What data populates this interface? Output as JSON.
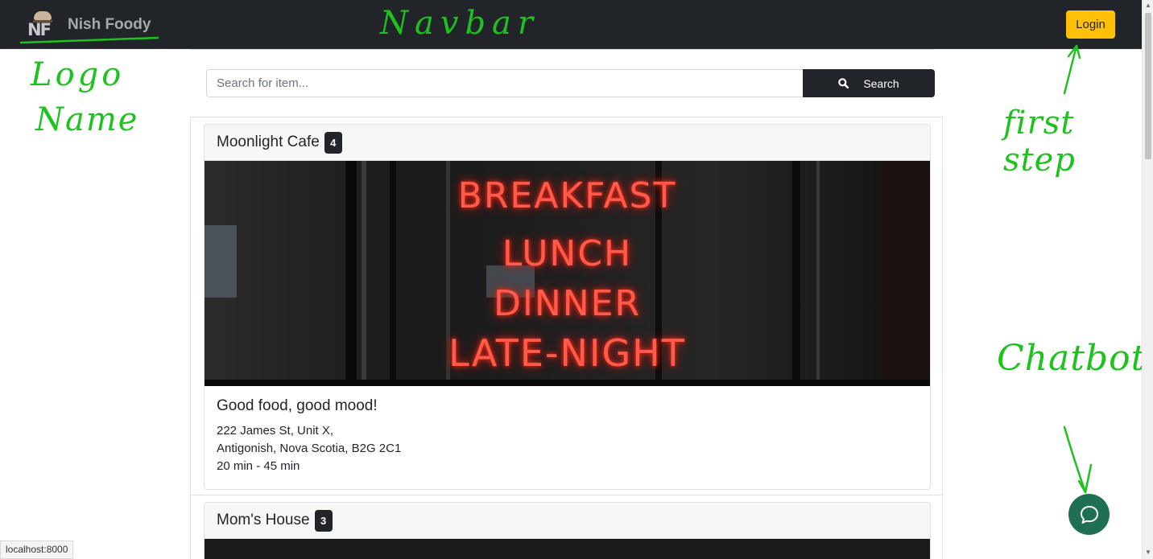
{
  "navbar": {
    "brand_logo_text": "NF",
    "brand_name": "Nish Foody",
    "login_label": "Login"
  },
  "search": {
    "placeholder": "Search for item...",
    "button_label": "Search"
  },
  "restaurants": [
    {
      "name": "Moonlight Cafe",
      "count": "4",
      "image_text": [
        "BREAKFAST",
        "LUNCH",
        "DINNER",
        "LATE-NIGHT"
      ],
      "tagline": "Good food, good mood!",
      "address_line1": "222 James St, Unit X,",
      "address_line2": "Antigonish, Nova Scotia, B2G 2C1",
      "delivery_time": "20 min - 45 min"
    },
    {
      "name": "Mom's House",
      "count": "3"
    }
  ],
  "annotations": {
    "navbar": "Navbar",
    "logo": "Logo",
    "name": "Name",
    "first_step": "first step",
    "chatbot": "Chatbot"
  },
  "status_bar": "localhost:8000",
  "colors": {
    "navbar_bg": "#212529",
    "login_bg": "#ffc107",
    "chat_bg": "#1f6f52",
    "annotation": "#1ec21e"
  },
  "icons": {
    "search": "search-icon",
    "chat": "chat-bubble-icon"
  }
}
